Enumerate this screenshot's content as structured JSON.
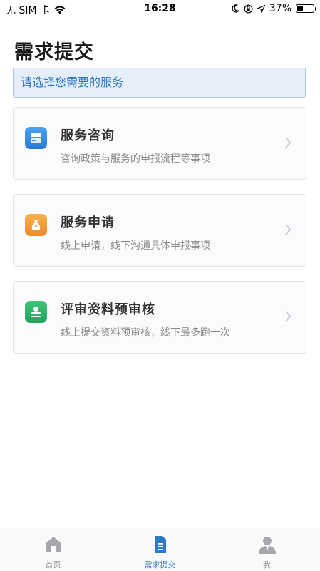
{
  "status_bar": {
    "carrier": "无 SIM 卡",
    "time": "16:28",
    "battery_percent": "37%",
    "battery_level": 0.37
  },
  "page": {
    "title": "需求提交",
    "hint": "请选择您需要的服务"
  },
  "services": [
    {
      "title": "服务咨询",
      "desc": "咨询政策与服务的申报流程等事项",
      "icon": "chat-icon",
      "color": "#3a8ee6"
    },
    {
      "title": "服务申请",
      "desc": "线上申请，线下沟通具体申报事项",
      "icon": "money-bag-icon",
      "color": "#f29a38"
    },
    {
      "title": "评审资料预审核",
      "desc": "线上提交资料预审核，线下最多跑一次",
      "icon": "review-icon",
      "color": "#2fb36a"
    }
  ],
  "tabs": [
    {
      "label": "首页",
      "icon": "home-icon"
    },
    {
      "label": "需求提交",
      "icon": "document-icon",
      "active": true
    },
    {
      "label": "我",
      "icon": "user-icon"
    }
  ],
  "colors": {
    "accent": "#2f78c4",
    "inactive": "#9a9a9a"
  }
}
